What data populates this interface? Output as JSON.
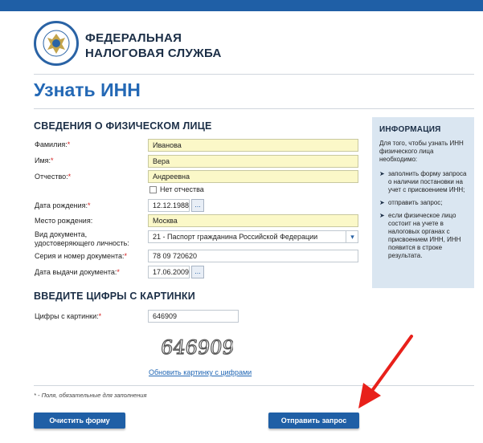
{
  "header": {
    "brand_line1": "ФЕДЕРАЛЬНАЯ",
    "brand_line2": "НАЛОГОВАЯ СЛУЖБА",
    "logo_text": "НАЛОГОВАЯ СЛУЖБА"
  },
  "page": {
    "title": "Узнать ИНН"
  },
  "personal": {
    "section_title": "СВЕДЕНИЯ О ФИЗИЧЕСКОМ ЛИЦЕ",
    "required_mark": "*",
    "surname_label": "Фамилия:",
    "surname_value": "Иванова",
    "name_label": "Имя:",
    "name_value": "Вера",
    "patronymic_label": "Отчество:",
    "patronymic_value": "Андреевна",
    "no_patronymic_label": "Нет отчества",
    "birth_date_label": "Дата рождения:",
    "birth_date_value": "12.12.1988",
    "birth_place_label": "Место рождения:",
    "birth_place_value": "Москва",
    "doc_type_label": "Вид документа, удостоверяющего личность:",
    "doc_type_value": "21 - Паспорт гражданина Российской Федерации",
    "doc_number_label": "Серия и номер документа:",
    "doc_number_value": "78 09 720620",
    "doc_date_label": "Дата выдачи документа:",
    "doc_date_value": "17.06.2009",
    "calendar_button": "..."
  },
  "captcha": {
    "section_title": "ВВЕДИТЕ ЦИФРЫ С КАРТИНКИ",
    "label": "Цифры с картинки:",
    "value": "646909",
    "image_text": "646909",
    "refresh_link": "Обновить картинку с цифрами"
  },
  "footnote": "* - Поля, обязательные для заполнения",
  "buttons": {
    "clear": "Очистить форму",
    "submit": "Отправить запрос"
  },
  "info": {
    "title": "ИНФОРМАЦИЯ",
    "intro": "Для того, чтобы узнать ИНН физического лица необходимо:",
    "items": [
      "заполнить форму запроса о наличии постановки на учет с присвоением ИНН;",
      "отправить запрос;",
      "если физическое лицо состоит на учете в налоговых органах с присвоением ИНН, ИНН появится в строке результата."
    ]
  },
  "colors": {
    "accent": "#1f5fa6",
    "title_blue": "#2368b5",
    "field_yellow": "#fbf8c8",
    "info_bg": "#dae6f1",
    "arrow_red": "#e8201a"
  }
}
